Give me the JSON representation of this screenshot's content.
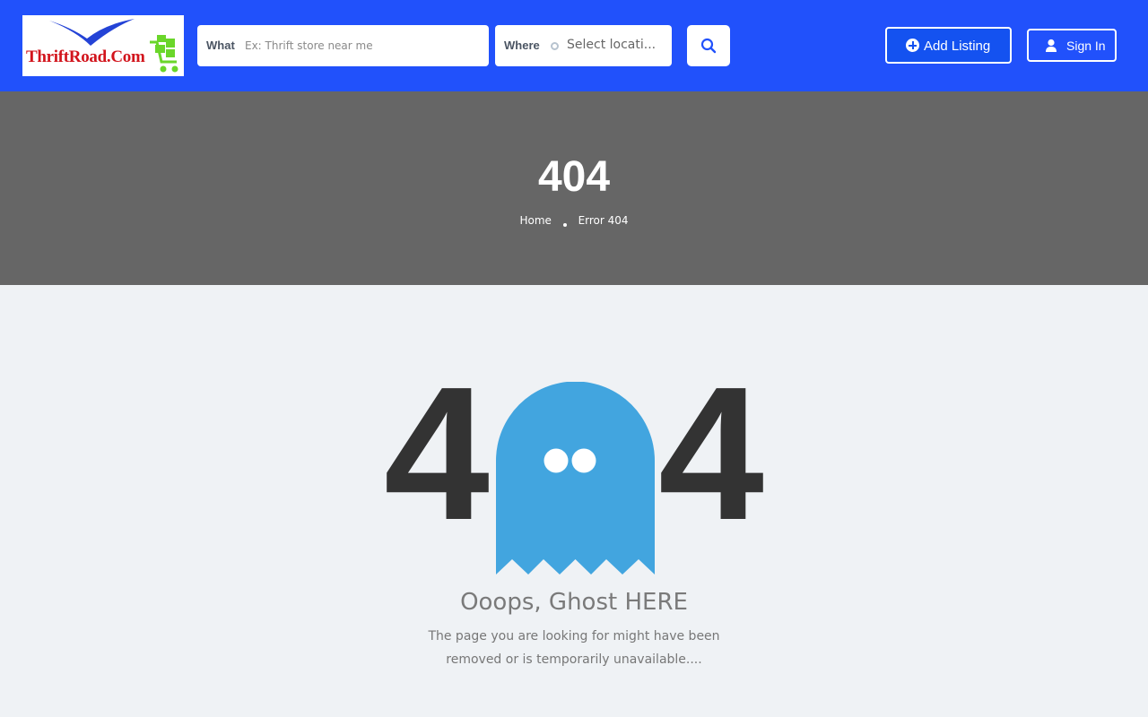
{
  "header": {
    "logo_text": "ThriftRoad.Com",
    "search": {
      "what_label": "What",
      "what_placeholder": "Ex: Thrift store near me",
      "where_label": "Where",
      "where_value": "Select locati...",
      "search_icon": "search-icon"
    },
    "add_listing_label": "Add Listing",
    "sign_in_label": "Sign In"
  },
  "banner": {
    "title": "404",
    "breadcrumb": [
      "Home",
      "Error 404"
    ]
  },
  "error": {
    "digit_left": "4",
    "digit_right": "4",
    "title": "Ooops, Ghost HERE",
    "message": "The page you are looking for might have been removed or is temporarily unavailable...."
  },
  "colors": {
    "header_bg": "#2151fb",
    "banner_bg": "#666666",
    "page_bg": "#eff2f5",
    "ghost": "#42a5df",
    "digits": "#333333"
  }
}
